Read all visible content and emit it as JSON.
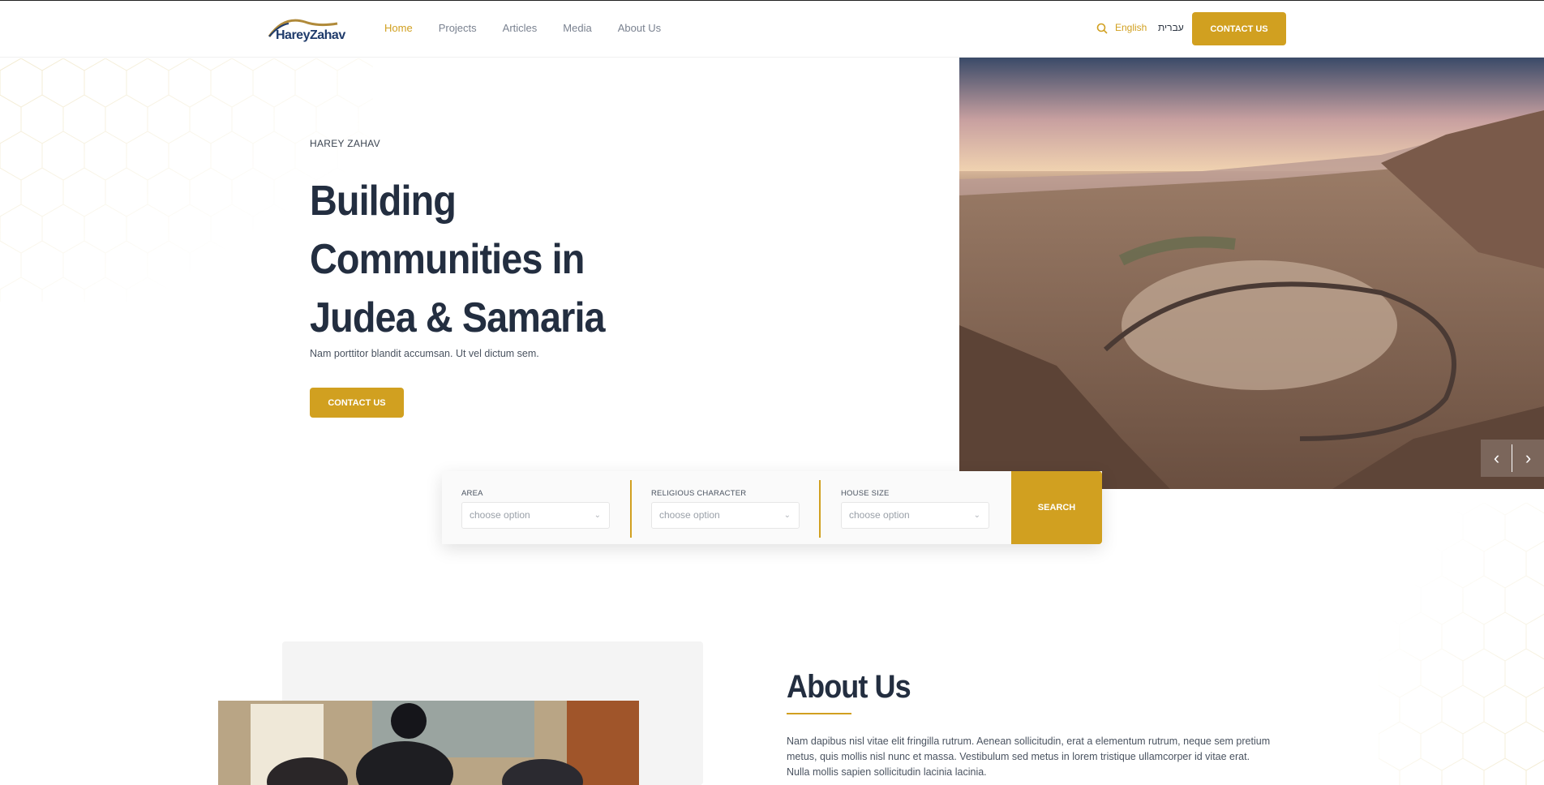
{
  "brand": {
    "logo_text": "HareyZahav"
  },
  "nav": {
    "items": [
      {
        "label": "Home",
        "active": true
      },
      {
        "label": "Projects",
        "active": false
      },
      {
        "label": "Articles",
        "active": false
      },
      {
        "label": "Media",
        "active": false
      },
      {
        "label": "About Us",
        "active": false
      }
    ]
  },
  "header": {
    "lang_en": "English",
    "lang_he": "עברית",
    "contact_label": "CONTACT US"
  },
  "hero": {
    "eyebrow": "HAREY ZAHAV",
    "title": "Building Communities in Judea & Samaria",
    "subtitle": "Nam porttitor blandit accumsan. Ut vel dictum sem.",
    "contact_label": "CONTACT US"
  },
  "search": {
    "fields": [
      {
        "label": "AREA",
        "placeholder": "choose option"
      },
      {
        "label": "RELIGIOUS CHARACTER",
        "placeholder": "choose option"
      },
      {
        "label": "HOUSE SIZE",
        "placeholder": "choose option"
      }
    ],
    "button_label": "SEARCH"
  },
  "about": {
    "title": "About Us",
    "text": "Nam dapibus nisl vitae elit fringilla rutrum. Aenean sollicitudin, erat a elementum rutrum, neque sem pretium metus, quis mollis nisl nunc et massa. Vestibulum sed metus in lorem tristique ullamcorper id vitae erat. Nulla mollis sapien sollicitudin lacinia lacinia."
  },
  "colors": {
    "accent": "#d1a020",
    "heading": "#232e40",
    "text": "#4a5360"
  },
  "icons": [
    "search-icon",
    "chevron-down-icon",
    "arrow-left-icon",
    "arrow-right-icon"
  ]
}
